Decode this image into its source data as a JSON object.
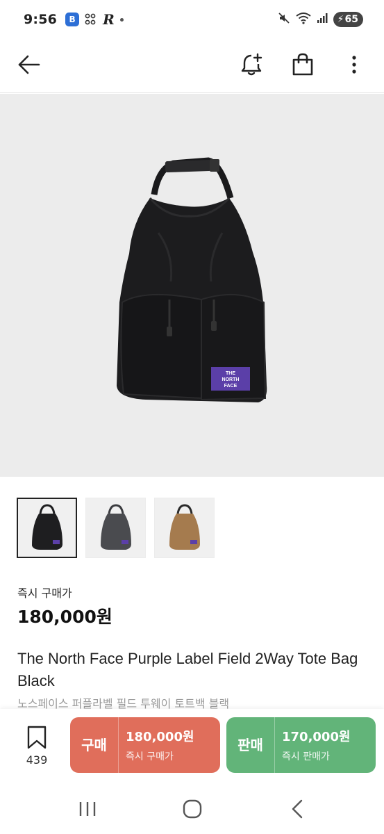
{
  "status_bar": {
    "time": "9:56",
    "battery": "65",
    "app_icon_letter": "B"
  },
  "header": {
    "back_icon": "arrow-left-icon",
    "alert_icon": "bell-plus-icon",
    "bag_icon": "shopping-bag-icon",
    "more_icon": "more-vertical-icon"
  },
  "product": {
    "brand_patch": [
      "THE",
      "NORTH",
      "FACE"
    ],
    "thumbnails": [
      {
        "color_name": "black",
        "color": "#1e1e20",
        "active": true
      },
      {
        "color_name": "gray",
        "color": "#4a4b4f",
        "active": false
      },
      {
        "color_name": "tan",
        "color": "#a57b4e",
        "active": false
      }
    ],
    "price_label": "즉시 구매가",
    "price": "180,000원",
    "title": "The North Face Purple Label Field 2Way Tote Bag Black",
    "subtitle": "노스페이스 퍼플라벨 필드 투웨이 토트백 블랙"
  },
  "actions": {
    "bookmark_count": "439",
    "buy": {
      "label": "구매",
      "price": "180,000원",
      "sub": "즉시 구매가",
      "color": "#e06e5b"
    },
    "sell": {
      "label": "판매",
      "price": "170,000원",
      "sub": "즉시 판매가",
      "color": "#62b479"
    }
  },
  "nav": {
    "recent_icon": "recent-apps-icon",
    "home_icon": "home-icon",
    "back_icon": "nav-back-icon"
  }
}
